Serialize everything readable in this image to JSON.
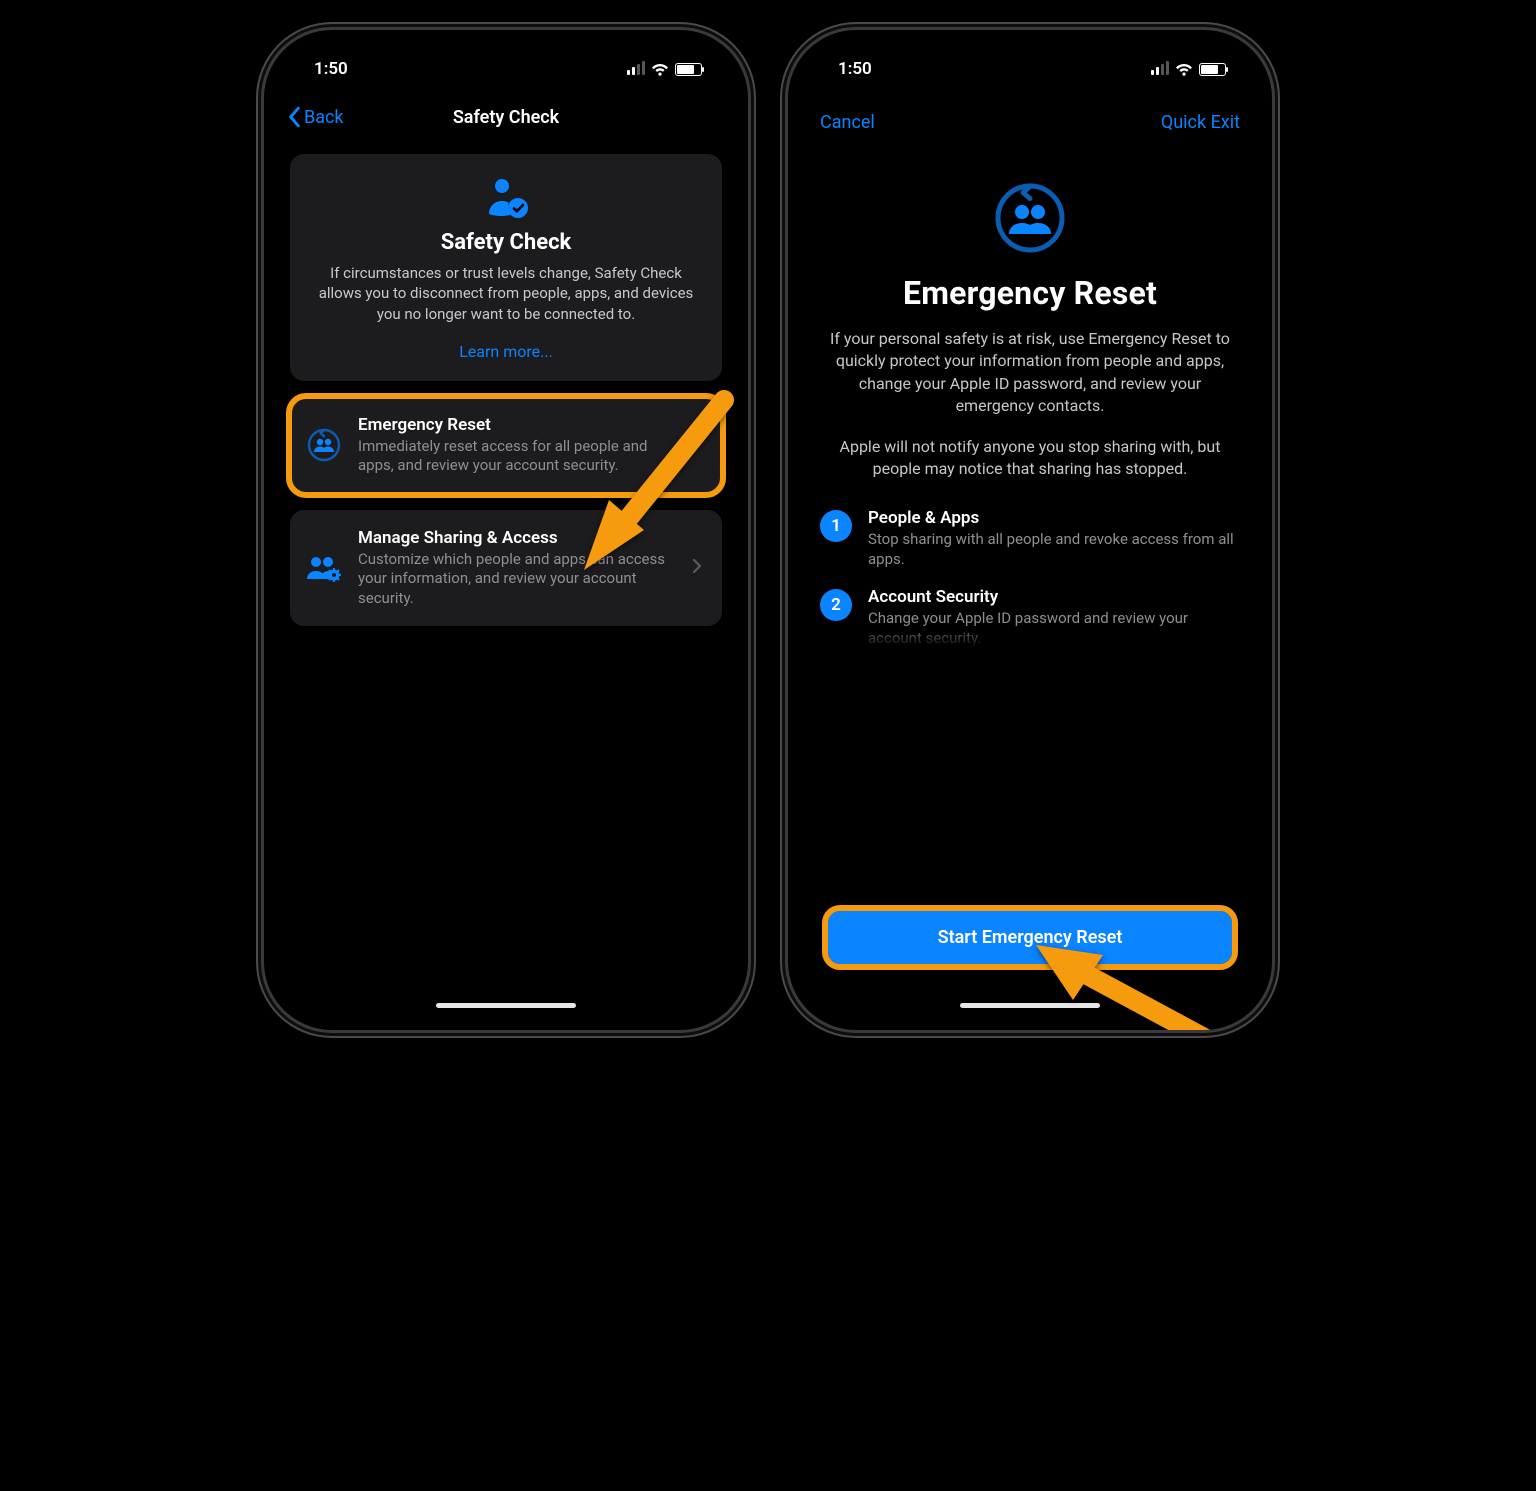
{
  "status": {
    "time": "1:50"
  },
  "screen1": {
    "nav": {
      "back": "Back",
      "title": "Safety Check"
    },
    "intro": {
      "heading": "Safety Check",
      "body": "If circumstances or trust levels change, Safety Check allows you to disconnect from people, apps, and devices you no longer want to be connected to.",
      "learn": "Learn more..."
    },
    "rows": [
      {
        "title": "Emergency Reset",
        "body": "Immediately reset access for all people and apps, and review your account security."
      },
      {
        "title": "Manage Sharing & Access",
        "body": "Customize which people and apps can access your information, and review your account security."
      }
    ]
  },
  "screen2": {
    "nav": {
      "cancel": "Cancel",
      "quickexit": "Quick Exit"
    },
    "hero": {
      "heading": "Emergency Reset",
      "p1": "If your personal safety is at risk, use Emergency Reset to quickly protect your information from people and apps, change your Apple ID password, and review your emergency contacts.",
      "p2": "Apple will not notify anyone you stop sharing with, but people may notice that sharing has stopped."
    },
    "steps": [
      {
        "n": "1",
        "title": "People & Apps",
        "body": "Stop sharing with all people and revoke access from all apps."
      },
      {
        "n": "2",
        "title": "Account Security",
        "body": "Change your Apple ID password and review your account security."
      }
    ],
    "cta": "Start Emergency Reset"
  }
}
